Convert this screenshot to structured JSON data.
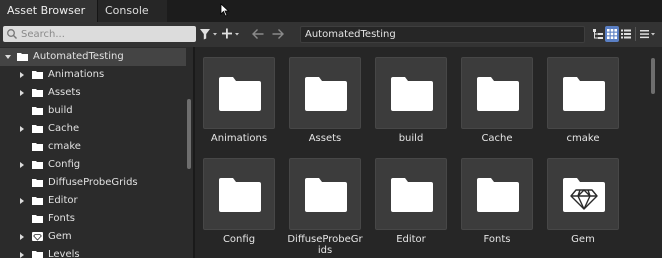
{
  "tabs": [
    {
      "label": "Asset Browser",
      "active": true
    },
    {
      "label": "Console",
      "active": false
    }
  ],
  "search": {
    "placeholder": "Search..."
  },
  "toolbar": {
    "path": "AutomatedTesting",
    "filter_icon": "filter-icon",
    "add_icon": "plus-icon",
    "back_icon": "arrow-left-icon",
    "forward_icon": "arrow-right-icon",
    "accent_color": "#5a7fc4"
  },
  "tree": {
    "root": "AutomatedTesting",
    "items": [
      {
        "label": "Animations",
        "expandable": true,
        "icon": "folder-icon"
      },
      {
        "label": "Assets",
        "expandable": true,
        "icon": "folder-icon"
      },
      {
        "label": "build",
        "expandable": false,
        "icon": "folder-icon"
      },
      {
        "label": "Cache",
        "expandable": true,
        "icon": "folder-icon"
      },
      {
        "label": "cmake",
        "expandable": false,
        "icon": "folder-icon"
      },
      {
        "label": "Config",
        "expandable": true,
        "icon": "folder-icon"
      },
      {
        "label": "DiffuseProbeGrids",
        "expandable": false,
        "icon": "folder-icon"
      },
      {
        "label": "Editor",
        "expandable": true,
        "icon": "folder-icon"
      },
      {
        "label": "Fonts",
        "expandable": false,
        "icon": "folder-icon"
      },
      {
        "label": "Gem",
        "expandable": true,
        "icon": "gem-icon"
      },
      {
        "label": "Levels",
        "expandable": true,
        "icon": "folder-icon"
      }
    ]
  },
  "grid": {
    "items": [
      {
        "label": "Animations",
        "icon": "folder-icon"
      },
      {
        "label": "Assets",
        "icon": "folder-icon"
      },
      {
        "label": "build",
        "icon": "folder-icon"
      },
      {
        "label": "Cache",
        "icon": "folder-icon"
      },
      {
        "label": "cmake",
        "icon": "folder-icon"
      },
      {
        "label": "Config",
        "icon": "folder-icon"
      },
      {
        "label": "DiffuseProbeGr\nids",
        "icon": "folder-icon"
      },
      {
        "label": "Editor",
        "icon": "folder-icon"
      },
      {
        "label": "Fonts",
        "icon": "folder-icon"
      },
      {
        "label": "Gem",
        "icon": "gem-icon"
      }
    ]
  }
}
